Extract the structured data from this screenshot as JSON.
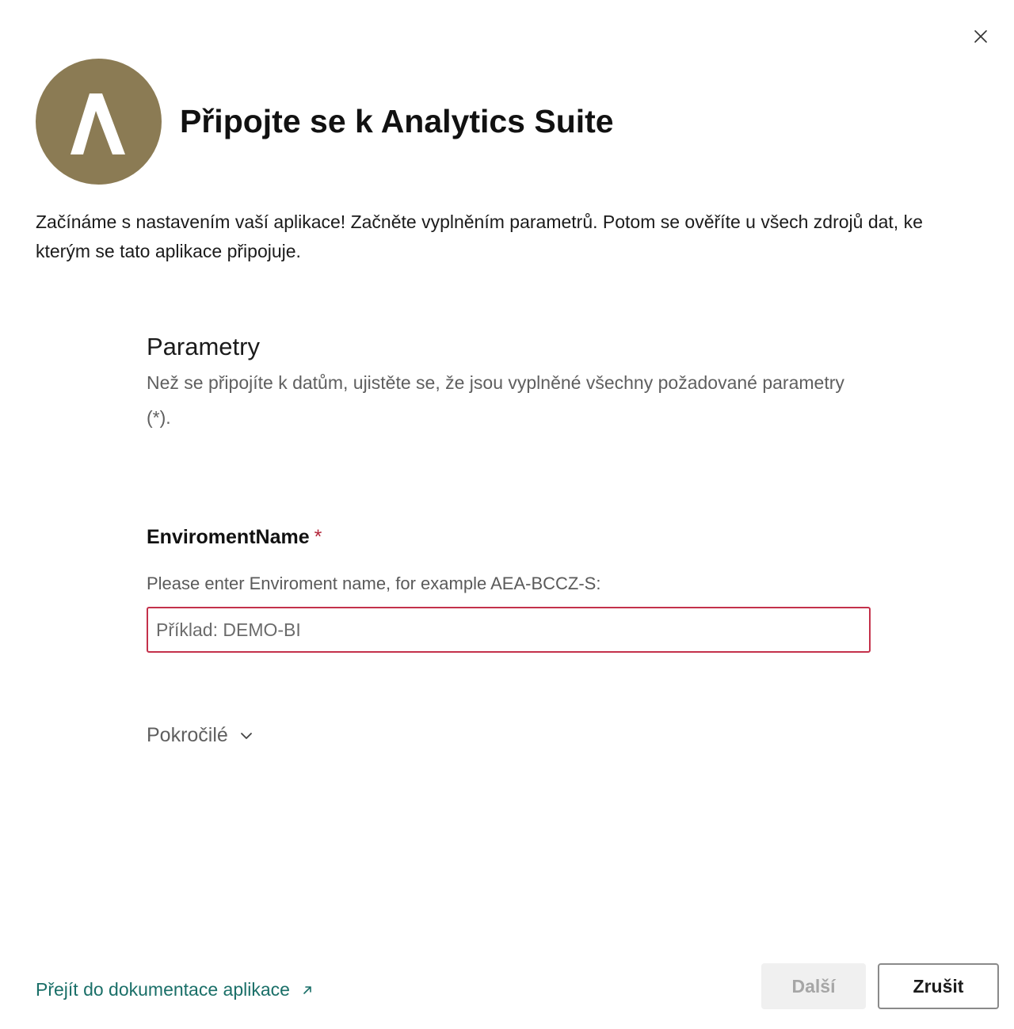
{
  "dialog": {
    "title": "Připojte se k Analytics Suite",
    "intro": "Začínáme s nastavením vaší aplikace! Začněte vyplněním parametrů. Potom se ověříte u všech zdrojů dat, ke kterým se tato aplikace připojuje.",
    "close_icon": "close-icon",
    "logo_icon": "analytics-suite-logo",
    "logo_color": "#8b7b54"
  },
  "parameters": {
    "title": "Parametry",
    "description": "Než se připojíte k datům, ujistěte se, že jsou vyplněné všechny požadované parametry (*).",
    "field": {
      "label": "EnviromentName",
      "required_mark": "*",
      "hint": "Please enter Enviroment name, for example AEA-BCCZ-S:",
      "value": "",
      "placeholder": "Příklad: DEMO-BI",
      "error_border_color": "#c4314b"
    },
    "advanced": {
      "label": "Pokročilé",
      "icon": "chevron-down-icon"
    }
  },
  "footer": {
    "doc_link": "Přejít do dokumentace aplikace",
    "doc_link_icon": "external-link-icon",
    "link_color": "#1a6f68",
    "next_label": "Další",
    "cancel_label": "Zrušit"
  }
}
